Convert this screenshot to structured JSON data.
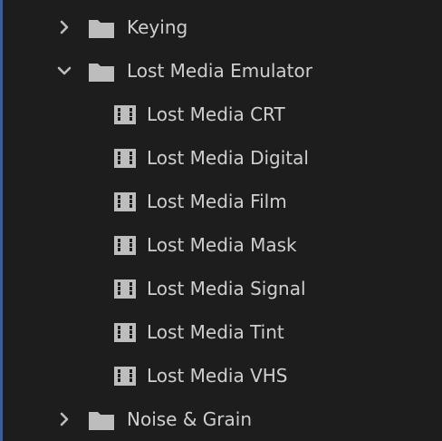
{
  "tree": {
    "folder_keying": {
      "label": "Keying",
      "expanded": false,
      "icon": "folder-icon"
    },
    "folder_lost_media": {
      "label": "Lost Media Emulator",
      "expanded": true,
      "icon": "folder-icon",
      "items": [
        {
          "label": "Lost Media CRT",
          "icon": "effect-clip-icon"
        },
        {
          "label": "Lost Media Digital",
          "icon": "effect-clip-icon"
        },
        {
          "label": "Lost Media Film",
          "icon": "effect-clip-icon"
        },
        {
          "label": "Lost Media Mask",
          "icon": "effect-clip-icon"
        },
        {
          "label": "Lost Media Signal",
          "icon": "effect-clip-icon"
        },
        {
          "label": "Lost Media Tint",
          "icon": "effect-clip-icon"
        },
        {
          "label": "Lost Media VHS",
          "icon": "effect-clip-icon"
        }
      ]
    },
    "folder_noise": {
      "label": "Noise & Grain",
      "expanded": false,
      "icon": "folder-icon"
    }
  },
  "colors": {
    "background": "#1d1d1d",
    "text": "#cfcfcf",
    "icon": "#bdbdbd",
    "focus_edge": "#3a5f9a"
  }
}
